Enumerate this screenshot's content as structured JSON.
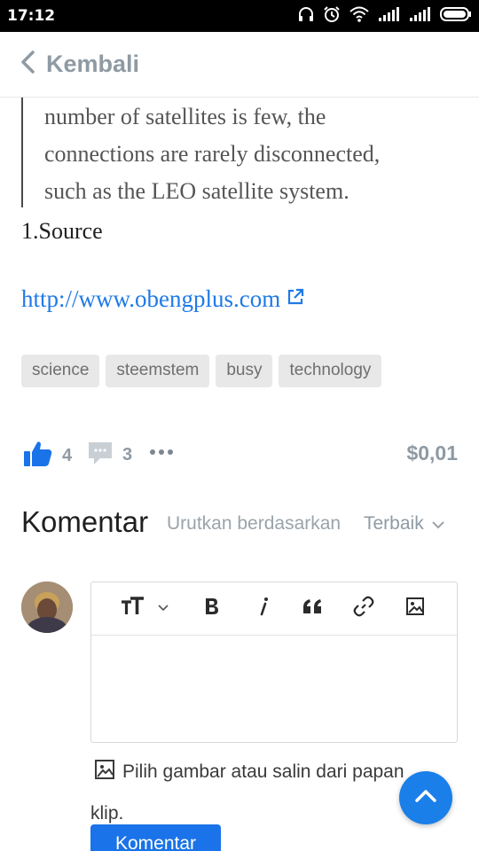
{
  "status_bar": {
    "time": "17:12"
  },
  "header": {
    "back_label": "Kembali"
  },
  "article": {
    "quote_lines": [
      "number of satellites is few, the",
      "connections are rarely disconnected,",
      "such as the LEO satellite system."
    ],
    "source_text": "1.Source",
    "link_text": "http://www.obengplus.com"
  },
  "tags": [
    "science",
    "steemstem",
    "busy",
    "technology"
  ],
  "actions": {
    "votes": "4",
    "comments": "3",
    "payout": "$0,01"
  },
  "comments": {
    "title": "Komentar",
    "sort_label": "Urutkan berdasarkan",
    "sort_value": "Terbaik",
    "pick_image_text": "Pilih gambar atau salin dari papan klip.",
    "submit_label": "Komentar"
  },
  "colors": {
    "accent": "#1a73e8",
    "link": "#1f7ae6",
    "muted": "#8f9aa3",
    "tag_bg": "#e8e8e8"
  }
}
